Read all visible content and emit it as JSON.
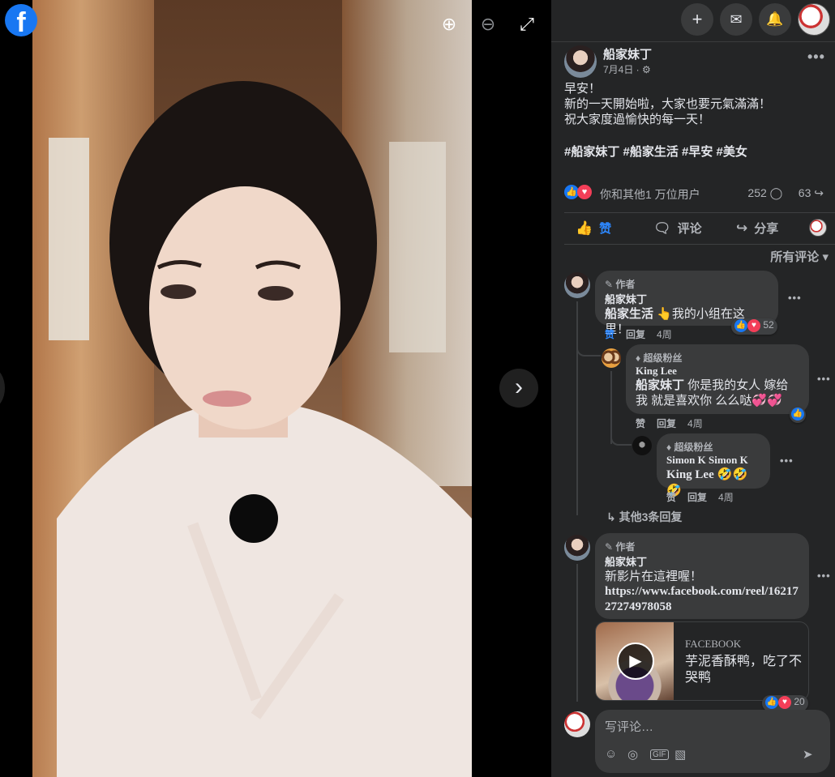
{
  "viewer": {
    "zoom_in_label": "⊕",
    "zoom_out_label": "⊖",
    "fullscreen_label": "⤢",
    "next_label": "›",
    "logo": "f"
  },
  "topbar": {
    "create_icon": "+",
    "messenger_icon": "✉",
    "notifications_icon": "🔔"
  },
  "post": {
    "author": "船家妹丁",
    "date": "7月4日 · ⚙",
    "lines": [
      "早安！",
      "新的一天開始啦，大家也要元氣滿滿！",
      "祝大家度過愉快的每一天！"
    ],
    "hashtags": "#船家妹丁 #船家生活 #早安 #美女",
    "reactions_text": "你和其他1 万位用户",
    "comment_count": "252 ◯",
    "share_count": "63 ↪"
  },
  "actions": {
    "like": "赞",
    "comment": "评论",
    "share": "分享"
  },
  "sort_label": "所有评论 ▾",
  "comments": [
    {
      "badge": "✎ 作者",
      "name": "船家妹丁",
      "bold": "船家生活",
      "text": " 👆我的小组在这里！",
      "like": "赞",
      "reply": "回复",
      "time": "4周",
      "react_count": "52"
    },
    {
      "badge": "♦ 超级粉丝",
      "name": "King Lee",
      "bold": "船家妹丁",
      "text": " 你是我的女人 嫁给我 就是喜欢你 么么哒💞💞",
      "like": "赞",
      "reply": "回复",
      "time": "4周"
    },
    {
      "badge": "♦ 超级粉丝",
      "name": "Simon K Simon K",
      "bold": "King Lee",
      "text": " 🤣🤣🤣",
      "like": "赞",
      "reply": "回复",
      "time": "4周"
    },
    {
      "badge": "✎ 作者",
      "name": "船家妹丁",
      "text": "新影片在這裡喔！",
      "link": "https://www.facebook.com/reel/1621727274978058",
      "react_count": "20"
    }
  ],
  "more_replies": "↳ 其他3条回复",
  "link_card": {
    "source": "FACEBOOK",
    "title": "芋泥香酥鸭，吃了不哭鸭"
  },
  "composer": {
    "placeholder": "写评论…",
    "tools": [
      "☺",
      "◎",
      "GIF",
      "▧"
    ],
    "send": "➤"
  },
  "colors": {
    "panel_bg": "#242526",
    "bubble_bg": "#3a3b3c",
    "accent": "#1877f2",
    "like_blue": "#2d88ff",
    "love_red": "#f33e58"
  }
}
